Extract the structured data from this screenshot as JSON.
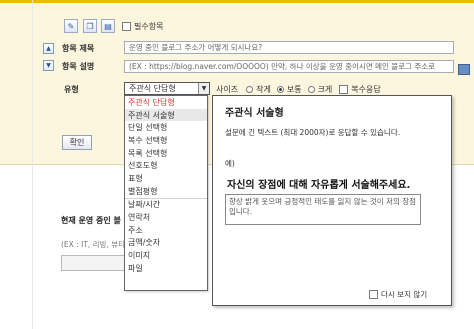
{
  "form": {
    "required_label": "필수항목",
    "title_label": "항목 제목",
    "title_value": "운영 중인 블로그 주소가 어떻게 되시나요?",
    "desc_label": "항목 설명",
    "desc_value": "(EX : https://blog.naver.com/OOOOO) 만약, 하나 이상을 운영 중이시면 메인 블로그 주소로",
    "type_label": "유형",
    "type_selected": "주관식 단답형",
    "size_label": "사이즈",
    "size_options": [
      "작게",
      "보통",
      "크게"
    ],
    "size_selected": "보통",
    "multi_answer_label": "복수응답",
    "confirm_label": "확인"
  },
  "dropdown": {
    "items": [
      "주관식 단답형",
      "주관식 서술형",
      "단일 선택형",
      "복수 선택형",
      "목록 선택형",
      "선호도형",
      "표형",
      "별점평형",
      "날짜/시간",
      "연락처",
      "주소",
      "금액/숫자",
      "이미지",
      "파일"
    ],
    "active_index": 0,
    "hover_index": 1
  },
  "tooltip": {
    "title": "주관식 서술형",
    "description": "설문에 긴 텍스트 (최대 2000자)로 응답할 수 있습니다.",
    "example_label": "예)",
    "example_question": "자신의 장점에 대해 자유롭게 서술해주세요.",
    "example_answer": "항상 밝게 웃으며 긍정적인 태도를 잃지 않는 것이 저의 장점입니다.",
    "hide_label": "다시 보지 않기"
  },
  "background": {
    "question": "현재 운영 중인 블",
    "hint": "(EX : IT, 리빙, 뷰티"
  }
}
